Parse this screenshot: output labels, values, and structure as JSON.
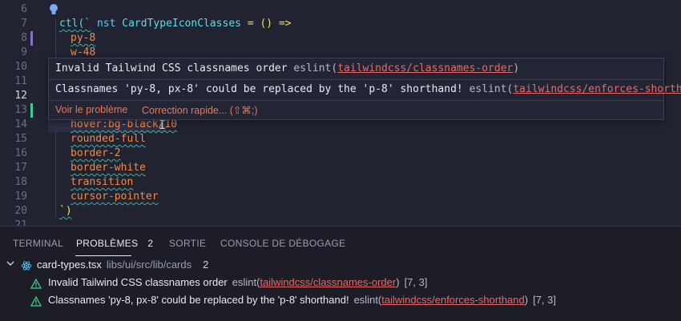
{
  "editor": {
    "lines": [
      {
        "n": "6",
        "pre": "",
        "kw": "",
        "name": "CardTypeIconClasses",
        "rest": ""
      },
      {
        "n": "7",
        "text": "ctl(`"
      },
      {
        "n": "8",
        "text": "py-8"
      },
      {
        "n": "9",
        "text": "w-48"
      },
      {
        "n": "10",
        "text": ""
      },
      {
        "n": "11",
        "text": ""
      },
      {
        "n": "12",
        "text": ""
      },
      {
        "n": "13",
        "text": ""
      },
      {
        "n": "14",
        "text": "hover:bg-black/10"
      },
      {
        "n": "15",
        "text": "rounded-full"
      },
      {
        "n": "16",
        "text": "border-2"
      },
      {
        "n": "17",
        "text": "border-white"
      },
      {
        "n": "18",
        "text": "transition"
      },
      {
        "n": "19",
        "text": "cursor-pointer"
      },
      {
        "n": "20",
        "text": "`)"
      },
      {
        "n": "21",
        "text": ""
      }
    ],
    "line6": {
      "kw": "nst",
      "name": "CardTypeIconClasses",
      "eq": " = ",
      "arrow": "() =>"
    }
  },
  "hover": {
    "msg1": "Invalid Tailwind CSS classnames order",
    "msg2": "Classnames 'py-8, px-8' could be replaced by the 'p-8' shorthand!",
    "src": "eslint(",
    "rule1": "tailwindcss/classnames-order",
    "rule2": "tailwindcss/enforces-shorthand",
    "close": ")",
    "view_problem": "Voir le problème",
    "quick_fix": "Correction rapide... (⇧⌘;)"
  },
  "panel": {
    "tabs": [
      "TERMINAL",
      "PROBLÈMES",
      "SORTIE",
      "CONSOLE DE DÉBOGAGE"
    ],
    "problems_count": "2",
    "file": "card-types.tsx",
    "path": "libs/ui/src/lib/cards",
    "file_count": "2",
    "problems": [
      {
        "message": "Invalid Tailwind CSS classnames order",
        "source": "eslint(",
        "rule": "tailwindcss/classnames-order",
        "close": ")",
        "pos": "[7, 3]"
      },
      {
        "message": "Classnames 'py-8, px-8' could be replaced by the 'p-8' shorthand!",
        "source": "eslint(",
        "rule": "tailwindcss/enforces-shorthand",
        "close": ")",
        "pos": "[7, 3]"
      }
    ]
  },
  "colors": {
    "accent": "#2fb9a4",
    "error": "#e46a6a",
    "warning": "#3ecf8e",
    "class_string": "#f08a4b"
  },
  "icons": [
    "lightbulb-icon",
    "react-icon",
    "warning-icon",
    "chevron-down-icon"
  ]
}
